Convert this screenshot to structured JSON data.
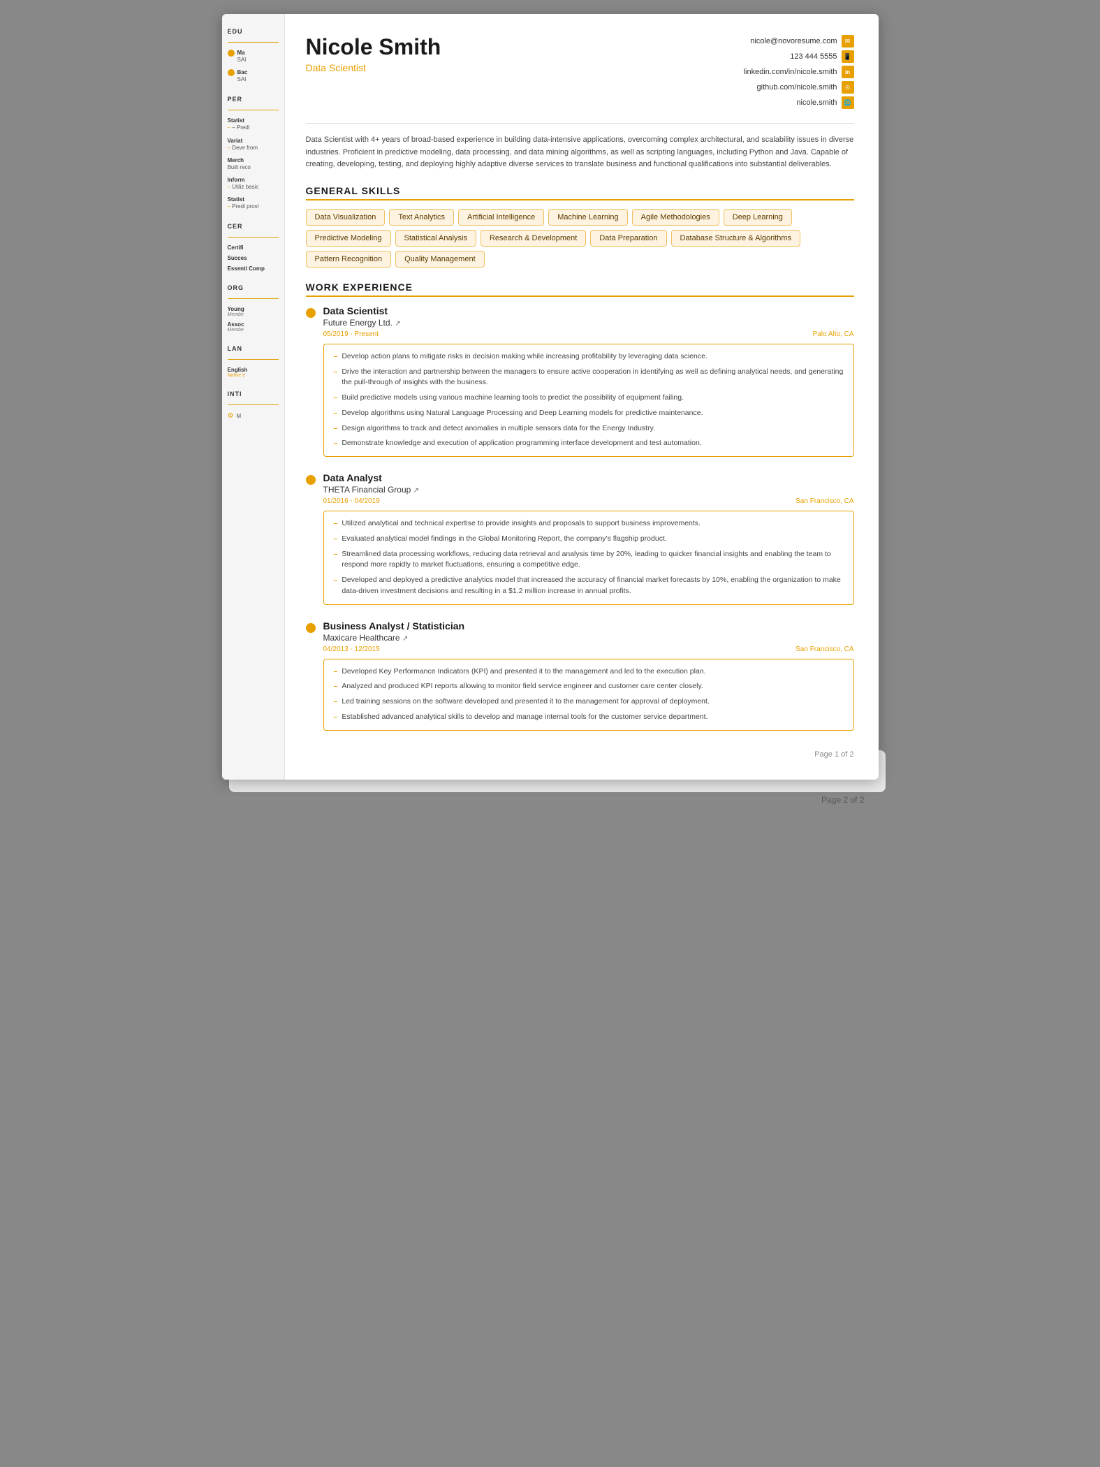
{
  "page": {
    "title": "Nicole Smith",
    "subtitle": "Data Scientist",
    "page_number": "Page 1 of 2",
    "page2_label": "Page 2 of 2"
  },
  "contact": {
    "email": "nicole@novoresume.com",
    "phone": "123 444 5555",
    "linkedin": "linkedin.com/in/nicole.smith",
    "github": "github.com/nicole.smith",
    "website": "nicole.smith"
  },
  "summary": "Data Scientist with 4+ years of broad-based experience in building data-intensive applications, overcoming complex architectural, and scalability issues in diverse industries. Proficient in predictive modeling, data processing, and data mining algorithms, as well as scripting languages, including Python and Java. Capable of creating, developing, testing, and deploying highly adaptive diverse services to translate business and functional qualifications into substantial deliverables.",
  "skills": {
    "title": "GENERAL SKILLS",
    "tags": [
      "Data Visualization",
      "Text Analytics",
      "Artificial Intelligence",
      "Machine Learning",
      "Agile Methodologies",
      "Deep Learning",
      "Predictive Modeling",
      "Statistical Analysis",
      "Research & Development",
      "Data Preparation",
      "Database Structure & Algorithms",
      "Pattern Recognition",
      "Quality Management"
    ]
  },
  "work_experience": {
    "title": "WORK EXPERIENCE",
    "jobs": [
      {
        "title": "Data Scientist",
        "company": "Future Energy Ltd.",
        "dates": "05/2019 - Present",
        "location": "Palo Alto, CA",
        "bullets": [
          "Develop action plans to mitigate risks in decision making while increasing profitability by leveraging data science.",
          "Drive the interaction and partnership between the managers to ensure active cooperation in identifying as well as defining analytical needs, and generating the pull-through of insights with the business.",
          "Build predictive models using various machine learning tools to predict the possibility of equipment failing.",
          "Develop algorithms using Natural Language Processing and Deep Learning models for predictive maintenance.",
          "Design algorithms to track and detect anomalies in multiple sensors data for the Energy Industry.",
          "Demonstrate knowledge and execution of application programming interface development and test automation."
        ]
      },
      {
        "title": "Data Analyst",
        "company": "THETA Financial Group",
        "dates": "01/2016 - 04/2019",
        "location": "San Francisco, CA",
        "bullets": [
          "Utilized analytical and technical expertise to provide insights and proposals to support business improvements.",
          "Evaluated analytical model findings in the Global Monitoring Report, the company's flagship product.",
          "Streamlined data processing workflows, reducing data retrieval and analysis time by 20%, leading to quicker financial insights and enabling the team to respond more rapidly to market fluctuations, ensuring a competitive edge.",
          "Developed and deployed a predictive analytics model that increased the accuracy of financial market forecasts by 10%, enabling the organization to make data-driven investment decisions and resulting in a $1.2 million increase in annual profits."
        ]
      },
      {
        "title": "Business Analyst / Statistician",
        "company": "Maxicare Healthcare",
        "dates": "04/2013 - 12/2015",
        "location": "San Francisco, CA",
        "bullets": [
          "Developed Key Performance Indicators (KPI) and presented it to the management and led to the execution plan.",
          "Analyzed and produced KPI reports allowing to monitor field service engineer and customer care center closely.",
          "Led training sessions on the software developed and presented it to the management for approval of deployment.",
          "Established advanced analytical skills to develop and manage internal tools for the customer service department."
        ]
      }
    ]
  },
  "sidebar": {
    "education": {
      "title": "EDU",
      "items": [
        {
          "degree": "Ma",
          "school": "SAI"
        },
        {
          "degree": "Bac",
          "school": "SAI"
        }
      ]
    },
    "personal_skills": {
      "title": "PER",
      "items": [
        {
          "name": "Statist",
          "detail": "– Predi"
        },
        {
          "name": "Variat",
          "detail": "– Deve from"
        },
        {
          "name": "Merch",
          "detail": "Built reco"
        },
        {
          "name": "Inform",
          "detail": "– Utiliz basic"
        },
        {
          "name": "Statist",
          "detail": "– Predi provi"
        }
      ]
    },
    "certifications": {
      "title": "CER",
      "items": [
        {
          "name": "Certifi"
        },
        {
          "name": "Succes"
        },
        {
          "name": "Essenti Comp"
        }
      ]
    },
    "organizations": {
      "title": "ORG",
      "items": [
        {
          "name": "Young",
          "role": "Membe"
        },
        {
          "name": "Assoc",
          "role": "Membe"
        }
      ]
    },
    "languages": {
      "title": "LAN",
      "items": [
        {
          "name": "English",
          "level": "Native e"
        }
      ]
    },
    "interests": {
      "title": "INTI",
      "items": [
        {
          "icon": "⚙",
          "text": "M"
        }
      ]
    }
  }
}
